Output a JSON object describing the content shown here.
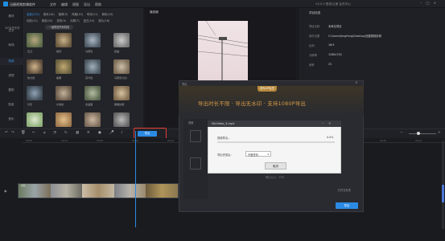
{
  "window": {
    "title": "迅捷视频剪辑软件",
    "menu": [
      "文件",
      "编辑",
      "视图",
      "导出",
      "帮助"
    ],
    "status_right": "V4.0.0  登录/注册  会员中心"
  },
  "left_rail": [
    {
      "label": "素材",
      "active": false
    },
    {
      "label": "文字",
      "active": false
    },
    {
      "label": "转场",
      "active": false
    },
    {
      "label": "特效",
      "active": true
    },
    {
      "label": "滤镜",
      "active": false
    },
    {
      "label": "叠附",
      "active": false
    },
    {
      "label": "贴纸",
      "active": false
    },
    {
      "label": "音乐",
      "active": false
    }
  ],
  "media": {
    "tabs_row1": [
      "全部(213)",
      "基本(16)",
      "推荐(9)",
      "风格(20)",
      "时尚(11)",
      "精彩(15)"
    ],
    "tabs_row2": [
      "动态(11)",
      "静态(20)",
      "变形(9)",
      "分屏(7)",
      "复古(10)",
      "胶片(16)"
    ],
    "active_tab": "全部(213)",
    "tagline": "VIP会员专享",
    "pill": "一键预览所有特效",
    "thumb_labels": [
      "凹凸",
      "旋转",
      "马赛克",
      "扭曲",
      "放大镜",
      "鱼眼",
      "百叶窗",
      "马赛克分割",
      "光影",
      "水波纹",
      "多画面",
      "模糊边框",
      "",
      "",
      "",
      ""
    ]
  },
  "player": {
    "title": "播放器"
  },
  "properties": {
    "title": "项目信息",
    "rows": [
      {
        "label": "项目名称",
        "value": "未命名项目"
      },
      {
        "label": "保存位置",
        "value": "C:\\Users\\fengFeng\\Desktop\\迅捷视频剪辑"
      },
      {
        "label": "比例",
        "value": "16:9"
      },
      {
        "label": "分辨率",
        "value": "1280x720"
      },
      {
        "label": "帧率",
        "value": "25"
      }
    ]
  },
  "toolbar": {
    "export_label": "导出",
    "ruler": [
      "00:00",
      "00:04",
      "00:08",
      "00:12",
      "00:16",
      "00:20",
      "00:24",
      "00:28",
      "00:32",
      "00:36",
      "00:40",
      "00:44"
    ]
  },
  "track": {
    "clip_title": "视频"
  },
  "export_dialog": {
    "title": "导出",
    "badge": "成为VIP会员",
    "banner": "导出时长不限 · 导出无水印 · 支持1080P导出",
    "side_label": "视频",
    "info": "预计大小：27M",
    "open_folder": "打开文件夹",
    "export_button": "导出"
  },
  "progress_dialog": {
    "title": "MyVideo_4.mp4",
    "label": "视频导出...",
    "percent_text": "0.0%",
    "progress": 0.0,
    "after_label": "导出完成后：",
    "after_value": "不做任何",
    "cancel_label": "取消"
  }
}
